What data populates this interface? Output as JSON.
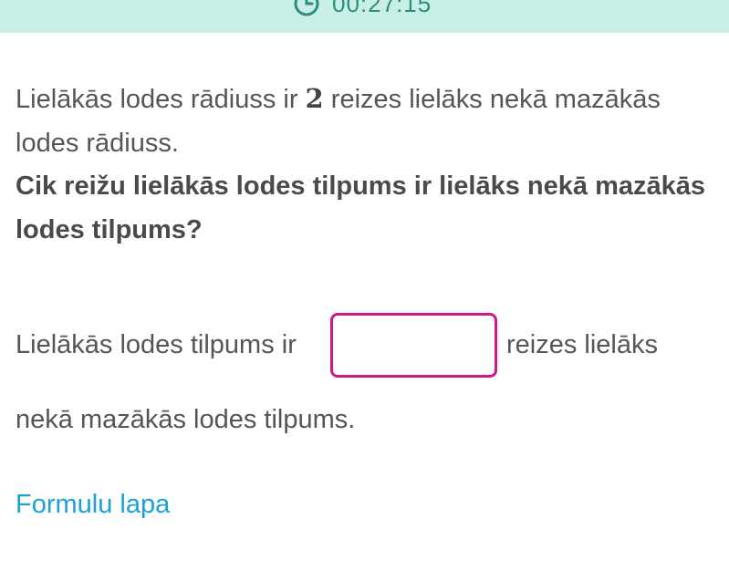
{
  "header": {
    "timer": "00:27:15",
    "timer_icon": "alarm-clock-icon",
    "background_color": "#c9eee5",
    "accent_color": "#2a8f7e"
  },
  "question": {
    "line1_before": "Lielākās lodes rādiuss ir ",
    "factor": "2",
    "line1_after": " reizes lielāks nekā mazākās lodes rādiuss.",
    "prompt": "Cik reižu lielākās lodes tilpums ir lielāks nekā mazākās lodes tilpums?"
  },
  "answer": {
    "before_box": "Lielākās lodes tilpums ir",
    "input_value": "",
    "after_box": "reizes lielāks",
    "continuation": "nekā mazākās lodes tilpums.",
    "box_border_color": "#cc1a8a"
  },
  "links": {
    "formula_sheet": "Formulu lapa",
    "link_color": "#1aa2d6"
  }
}
